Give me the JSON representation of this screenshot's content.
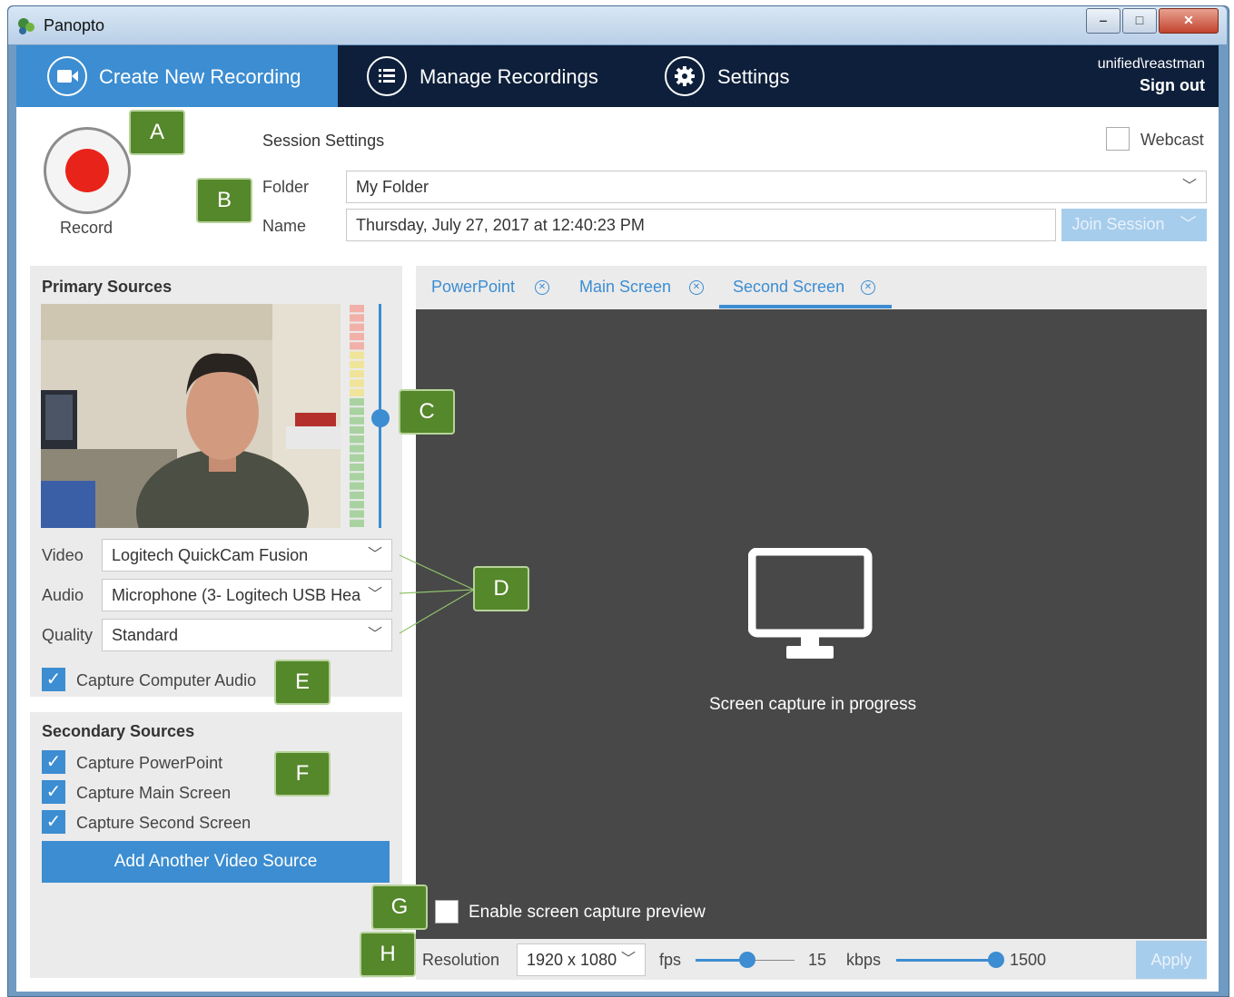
{
  "window": {
    "title": "Panopto",
    "min": "‒",
    "max": "□",
    "close": "✕"
  },
  "nav": {
    "create_label": "Create New Recording",
    "manage_label": "Manage Recordings",
    "settings_label": "Settings",
    "user_name": "unified\\reastman",
    "sign_out": "Sign out"
  },
  "record": {
    "label": "Record"
  },
  "session": {
    "heading": "Session Settings",
    "webcast_label": "Webcast",
    "folder_label": "Folder",
    "folder_value": "My Folder",
    "name_label": "Name",
    "name_value": "Thursday, July 27, 2017 at 12:40:23 PM",
    "join_label": "Join Session"
  },
  "primary": {
    "heading": "Primary Sources",
    "video_label": "Video",
    "video_value": "Logitech QuickCam Fusion",
    "audio_label": "Audio",
    "audio_value": "Microphone (3- Logitech USB Hea",
    "quality_label": "Quality",
    "quality_value": "Standard",
    "capture_audio_label": "Capture Computer Audio",
    "capture_audio_checked": true,
    "audio_level_fraction": 0.49
  },
  "secondary": {
    "heading": "Secondary Sources",
    "items": [
      {
        "label": "Capture PowerPoint",
        "checked": true
      },
      {
        "label": "Capture Main Screen",
        "checked": true
      },
      {
        "label": "Capture Second Screen",
        "checked": true
      }
    ],
    "add_button": "Add Another Video Source"
  },
  "preview": {
    "tabs": [
      {
        "label": "PowerPoint",
        "active": false
      },
      {
        "label": "Main Screen",
        "active": false
      },
      {
        "label": "Second Screen",
        "active": true
      }
    ],
    "status": "Screen capture in progress",
    "enable_preview_label": "Enable screen capture preview",
    "resolution_label": "Resolution",
    "resolution_value": "1920 x 1080",
    "fps_label": "fps",
    "fps_value": "15",
    "kbps_label": "kbps",
    "kbps_value": "1500",
    "apply_label": "Apply"
  },
  "callouts": [
    "A",
    "B",
    "C",
    "D",
    "E",
    "F",
    "G",
    "H"
  ],
  "colors": {
    "accent": "#3c8dd1",
    "nav": "#0d1f3a",
    "callout": "#55872b",
    "record": "#e8231a",
    "preview_bg": "#484848"
  }
}
